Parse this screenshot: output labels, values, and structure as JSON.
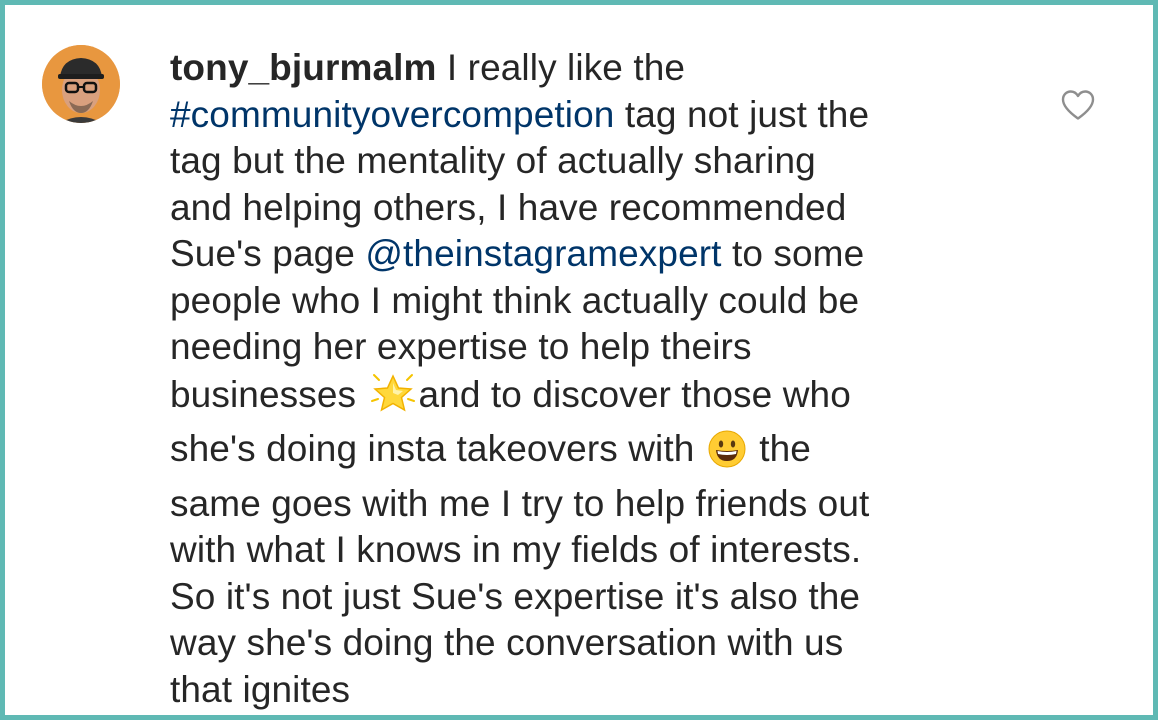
{
  "comment": {
    "username": "tony_bjurmalm",
    "lines": [
      {
        "before": " I really like the"
      },
      {
        "link": "#communityovercompetion",
        "after": " tag not just the"
      },
      {
        "text": "tag but the mentality of actually sharing"
      },
      {
        "text": "and helping others, I have recommended"
      },
      {
        "before": "Sue's page ",
        "link": "@theinstagramexpert",
        "after": " to some"
      },
      {
        "text": "people who I might think actually could be"
      },
      {
        "text": "needing her expertise to help theirs"
      },
      {
        "before": "businesses ",
        "after": "and to discover those who"
      },
      {
        "before": "she's doing insta takeovers with ",
        "after": " the"
      },
      {
        "text": "same goes with me I try to help friends out"
      },
      {
        "text": "with what I knows in my fields of interests."
      },
      {
        "text": "So it's not just Sue's expertise it's also the"
      },
      {
        "text": "way she's doing the conversation with us"
      },
      {
        "text": "that ignites"
      }
    ]
  },
  "icons": {
    "avatar": "user-avatar",
    "like": "heart-outline-icon",
    "star_emoji": "glowing-star-emoji",
    "smile_emoji": "grinning-face-emoji"
  },
  "colors": {
    "border": "#5fb9b4",
    "text": "#262626",
    "link": "#003569",
    "icon": "#8e8e8e"
  }
}
